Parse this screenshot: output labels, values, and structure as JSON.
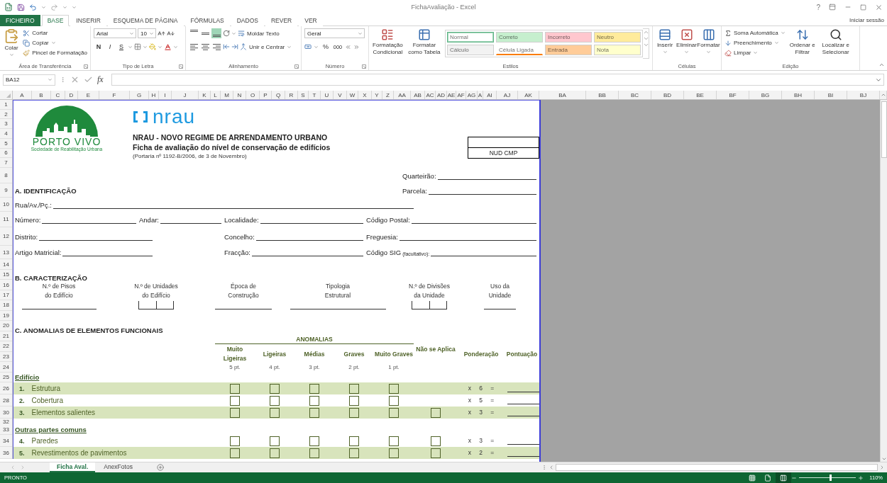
{
  "window": {
    "title": "FichaAvaliação - Excel",
    "help": "?"
  },
  "ribbon_tabs": [
    {
      "label": "FICHEIRO",
      "kind": "file",
      "selected": false
    },
    {
      "label": "BASE",
      "kind": "tab",
      "selected": true
    },
    {
      "label": "INSERIR",
      "kind": "tab",
      "selected": false
    },
    {
      "label": "ESQUEMA DE PÁGINA",
      "kind": "tab",
      "selected": false
    },
    {
      "label": "FÓRMULAS",
      "kind": "tab",
      "selected": false
    },
    {
      "label": "DADOS",
      "kind": "tab",
      "selected": false
    },
    {
      "label": "REVER",
      "kind": "tab",
      "selected": false
    },
    {
      "label": "VER",
      "kind": "tab",
      "selected": false
    }
  ],
  "account": "Iniciar sessão",
  "ribbon": {
    "clipboard": {
      "paste": "Colar",
      "cut": "Cortar",
      "copy": "Copiar",
      "format_painter": "Pincel de Formatação",
      "label": "Área de Transferência"
    },
    "font": {
      "font_name": "Arial",
      "font_size": "10",
      "bold": "N",
      "italic": "I",
      "underline": "S",
      "label": "Tipo de Letra"
    },
    "alignment": {
      "vertical": [
        {
          "selected": false
        },
        {
          "selected": false
        },
        {
          "selected": true
        }
      ],
      "wrap": "Moldar Texto",
      "merge": "Unir e Centrar",
      "label": "Alinhamento"
    },
    "number": {
      "format": "Geral",
      "percent": "%",
      "thousands": "000",
      "label": "Número"
    },
    "styles": {
      "conditional": "Formatação Condicional",
      "as_table": "Formatar como Tabela",
      "label": "Estilos",
      "cells": [
        {
          "label": "Normal",
          "color": "#ffffff",
          "selected": true
        },
        {
          "label": "Correto",
          "color": "#c6efce",
          "selected": false
        },
        {
          "label": "Incorreto",
          "color": "#ffc7ce",
          "selected": false
        },
        {
          "label": "Neutro",
          "color": "#ffeb9c",
          "selected": false
        },
        {
          "label": "Cálculo",
          "color": "#f2f2f2",
          "selected": false
        },
        {
          "label": "Célula Ligada",
          "color": "#ffffff",
          "selected": false
        },
        {
          "label": "Entrada",
          "color": "#ffcc99",
          "selected": false
        },
        {
          "label": "Nota",
          "color": "#ffffcc",
          "selected": false
        }
      ]
    },
    "cells": {
      "buttons": [
        "Inserir",
        "Eliminar",
        "Formatar"
      ],
      "label": "Células"
    },
    "editing": {
      "autosum": "Soma Automática",
      "fill": "Preenchimento",
      "clear": "Limpar",
      "sort": "Ordenar e Filtrar",
      "find": "Localizar e Selecionar",
      "label": "Edição"
    }
  },
  "formula_bar": {
    "name_box": "BA12",
    "function_label": "fx"
  },
  "columns": [
    "A",
    "B",
    "C",
    "D",
    "E",
    "F",
    "G",
    "H",
    "I",
    "J",
    "K",
    "L",
    "M",
    "N",
    "O",
    "P",
    "Q",
    "R",
    "S",
    "T",
    "U",
    "V",
    "W",
    "X",
    "Y",
    "Z",
    "AA",
    "AB",
    "AC",
    "AD",
    "AE",
    "AF",
    "AG",
    "A",
    "AI",
    "AJ",
    "AK",
    "BA",
    "BB",
    "BC",
    "BD",
    "BE",
    "BF",
    "BG",
    "BH",
    "BI",
    "BJ"
  ],
  "sheet": {
    "header": {
      "rows": [
        "1",
        "2",
        "3",
        "4",
        "5",
        "6",
        "7"
      ],
      "org_name": "PORTO VIVO",
      "org_tagline": "Sociedade de Reabilitação Urbana",
      "program_logo": "nrau",
      "title": "NRAU - NOVO REGIME DE ARRENDAMENTO URBANO",
      "subtitle": "Ficha de avaliação do nível de conservação de edifícios",
      "reference": "(Portaria nº 1192-B/2006, de 3 de Novembro)",
      "code_box": "NUD CMP"
    },
    "identification": [
      {
        "row": "8",
        "kind": "right",
        "fields": [
          {
            "label": "Quarteirão:"
          }
        ]
      },
      {
        "row": "9",
        "kind": "right",
        "heading": "A. IDENTIFICAÇÃO",
        "fields": [
          {
            "label": "Parcela:"
          }
        ]
      },
      {
        "row": "10",
        "kind": "wide",
        "fields": [
          {
            "label": "Rua/Av./Pç.:"
          }
        ]
      },
      {
        "row": "11",
        "kind": "grid4",
        "fields": [
          {
            "label": "Número:"
          },
          {
            "label": "Andar:"
          },
          {
            "label": "Localidade:"
          },
          {
            "label": "Código Postal:"
          }
        ]
      },
      {
        "row": "12",
        "kind": "grid3",
        "fields": [
          {
            "label": "Distrito:"
          },
          {
            "label": "Concelho:"
          },
          {
            "label": "Freguesia:"
          }
        ]
      },
      {
        "row": "13",
        "kind": "grid3",
        "fields": [
          {
            "label": "Artigo Matricial:"
          },
          {
            "label": "Fracção:"
          },
          {
            "label": "Código SIG",
            "note": "(facultativo):"
          }
        ]
      },
      {
        "row": "14",
        "kind": "blank"
      }
    ],
    "characterization": {
      "rows": [
        "15",
        "16",
        "17",
        "18",
        "19"
      ],
      "heading": "B. CARACTERIZAÇÃO",
      "items": [
        {
          "label_lines": [
            "N.º de Pisos",
            "do Edifício"
          ],
          "kind": "line"
        },
        {
          "label_lines": [
            "N.º de Unidades",
            "do Edifício"
          ],
          "kind": "boxes"
        },
        {
          "label_lines": [
            "Época de",
            "Construção"
          ],
          "kind": "line"
        },
        {
          "label_lines": [
            "Tipologia",
            "Estrutural"
          ],
          "kind": "line"
        },
        {
          "label_lines": [
            "N.º de Divisões",
            "da Unidade"
          ],
          "kind": "boxes"
        },
        {
          "label_lines": [
            "Uso da",
            "Unidade"
          ],
          "kind": "line"
        }
      ]
    },
    "anomalies": {
      "rows": [
        "20",
        "21",
        "22",
        "23",
        "24"
      ],
      "heading": "C. ANOMALIAS DE ELEMENTOS FUNCIONAIS",
      "group_label": "ANOMALIAS",
      "levels": [
        {
          "name": "Muito Ligeiras",
          "points": "5 pt."
        },
        {
          "name": "Ligeiras",
          "points": "4 pt."
        },
        {
          "name": "Médias",
          "points": "3 pt."
        },
        {
          "name": "Graves",
          "points": "2 pt."
        },
        {
          "name": "Muito Graves",
          "points": "1 pt."
        }
      ],
      "not_applicable": "Não se Aplica",
      "weighting": "Ponderação",
      "score": "Pontuação"
    },
    "elements": [
      {
        "row": "25",
        "kind": "group",
        "label": "Edifício"
      },
      {
        "row": "26",
        "kind": "item",
        "number": "1.",
        "label": "Estrutura",
        "highlighted": true,
        "weight": "x 6 =",
        "boxes": [
          {
            "checked": false
          },
          {
            "checked": false
          },
          {
            "checked": false
          },
          {
            "checked": false
          },
          {
            "checked": false
          }
        ]
      },
      {
        "row": "28",
        "kind": "item",
        "number": "2.",
        "label": "Cobertura",
        "highlighted": false,
        "weight": "x 5 =",
        "boxes": [
          {
            "checked": false
          },
          {
            "checked": false
          },
          {
            "checked": false
          },
          {
            "checked": false
          },
          {
            "checked": false
          }
        ]
      },
      {
        "row": "30",
        "kind": "item",
        "number": "3.",
        "label": "Elementos salientes",
        "highlighted": true,
        "weight": "x 3 =",
        "boxes": [
          {
            "checked": false
          },
          {
            "checked": false
          },
          {
            "checked": false
          },
          {
            "checked": false
          },
          {
            "checked": false
          }
        ],
        "not_applicable": {
          "checked": false
        }
      },
      {
        "row": "32",
        "kind": "blank"
      },
      {
        "row": "33",
        "kind": "group",
        "label": "Outras partes comuns"
      },
      {
        "row": "34",
        "kind": "item",
        "number": "4.",
        "label": "Paredes",
        "highlighted": false,
        "weight": "x 3 =",
        "boxes": [
          {
            "checked": false
          },
          {
            "checked": false
          },
          {
            "checked": false
          },
          {
            "checked": false
          },
          {
            "checked": false
          }
        ],
        "not_applicable": {
          "checked": false
        }
      },
      {
        "row": "36",
        "kind": "item",
        "number": "5.",
        "label": "Revestimentos de pavimentos",
        "highlighted": true,
        "weight": "x 2 =",
        "boxes": [
          {
            "checked": false
          },
          {
            "checked": false
          },
          {
            "checked": false
          },
          {
            "checked": false
          },
          {
            "checked": false
          }
        ],
        "not_applicable": {
          "checked": false
        }
      }
    ]
  },
  "sheet_tabs": [
    {
      "label": "Ficha Aval.",
      "selected": true
    },
    {
      "label": "AnexFotos",
      "selected": false
    }
  ],
  "status_bar": {
    "status": "PRONTO",
    "views": [
      {
        "selected": false
      },
      {
        "selected": false
      },
      {
        "selected": true
      }
    ],
    "zoom": {
      "level": 0.55,
      "reading": "110%"
    }
  }
}
